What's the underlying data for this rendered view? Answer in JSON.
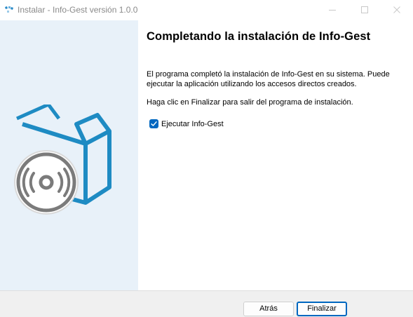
{
  "window": {
    "title": "Instalar - Info-Gest versión 1.0.0"
  },
  "main": {
    "heading": "Completando la instalación de Info-Gest",
    "paragraph1_line1": "El programa completó la instalación de Info-Gest en su sistema. Puede",
    "paragraph1_line2": "ejecutar la aplicación utilizando los accesos directos creados.",
    "paragraph2": "Haga clic en Finalizar para salir del programa de instalación.",
    "run_checkbox": {
      "label": "Ejecutar Info-Gest",
      "checked": true
    }
  },
  "footer": {
    "back_label": "Atrás",
    "finish_label": "Finalizar"
  },
  "colors": {
    "accent": "#0067c0",
    "side_panel": "#e8f1f9",
    "art_blue": "#1e8bc3",
    "art_gray": "#7b7b7b"
  },
  "icons": [
    "installer-app-icon",
    "minimize-icon",
    "maximize-icon",
    "close-icon",
    "box-disc-icon",
    "checkmark-icon"
  ]
}
